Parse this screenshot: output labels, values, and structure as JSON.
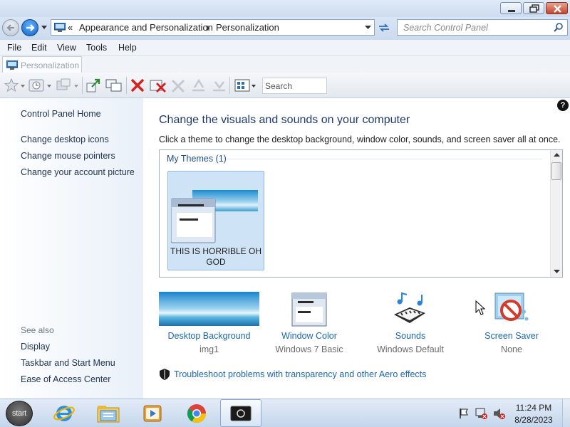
{
  "address": {
    "overflow_glyph": "«",
    "crumbs": [
      "Appearance and Personalization",
      "Personalization"
    ],
    "search_placeholder": "Search Control Panel"
  },
  "menu": [
    "File",
    "Edit",
    "View",
    "Tools",
    "Help"
  ],
  "tab": {
    "label": "Personalization"
  },
  "toolbar": {
    "search_placeholder": "Search"
  },
  "sidebar": {
    "home": "Control Panel Home",
    "links": [
      "Change desktop icons",
      "Change mouse pointers",
      "Change your account picture"
    ],
    "see_also_title": "See also",
    "see_also": [
      "Display",
      "Taskbar and Start Menu",
      "Ease of Access Center"
    ]
  },
  "main": {
    "help": "?",
    "heading": "Change the visuals and sounds on your computer",
    "subtext": "Click a theme to change the desktop background, window color, sounds, and screen saver all at once.",
    "themes_group": "My Themes (1)",
    "theme_name": "THIS IS HORRIBLE OH GOD",
    "settings": [
      {
        "label": "Desktop Background",
        "value": "img1"
      },
      {
        "label": "Window Color",
        "value": "Windows 7 Basic"
      },
      {
        "label": "Sounds",
        "value": "Windows Default"
      },
      {
        "label": "Screen Saver",
        "value": "None"
      }
    ],
    "troubleshoot": "Troubleshoot problems with transparency and other Aero effects"
  },
  "taskbar": {
    "start_label": "start",
    "time": "11:24 PM",
    "date": "8/28/2023",
    "apps": [
      "internet-explorer-icon",
      "windows-explorer-icon",
      "media-player-icon",
      "chrome-icon",
      "active-window-icon"
    ]
  },
  "colors": {
    "link": "#1b66b3",
    "heading": "#1f3a6e",
    "tile_selected": "#cfe3f7",
    "window_frame": "#dde8f5"
  }
}
